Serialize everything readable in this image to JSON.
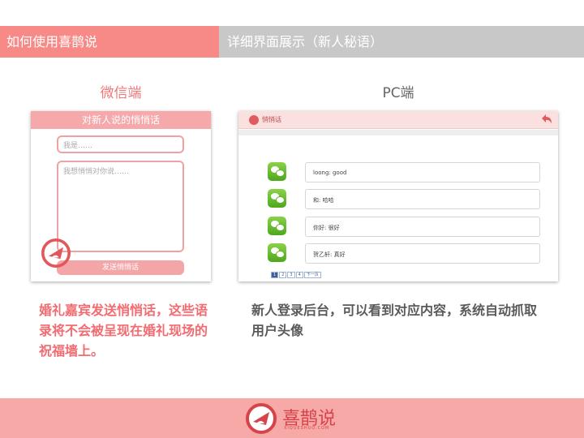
{
  "header": {
    "left_title": "如何使用喜鹊说",
    "right_title": "详细界面展示（新人秘语）"
  },
  "weixin": {
    "column_title": "微信端",
    "panel_title": "对新人说的悄悄话",
    "name_placeholder": "我是……",
    "message_placeholder": "我想悄悄对你说……",
    "send_label": "发送悄悄话",
    "description": "婚礼嘉宾发送悄悄话，这些语录将不会被呈现在婚礼现场的祝福墙上。"
  },
  "pc": {
    "column_title": "PC端",
    "panel_title": "悄悄话",
    "messages": [
      {
        "text": "loong:  good"
      },
      {
        "text": "和:  哈哈"
      },
      {
        "text": "你好:  很好"
      },
      {
        "text": "贺乙轩:  真好"
      }
    ],
    "pager": [
      "1",
      "2",
      "3",
      "4",
      "下一页"
    ],
    "description": "新人登录后台，可以看到对应内容，系统自动抓取用户头像"
  },
  "footer": {
    "brand_name": "喜鹊说",
    "brand_url": "XIQUESHUO.COM"
  },
  "colors": {
    "accent": "#f78a86",
    "gray_bar": "#c8c8c8",
    "footer_bg": "#f7a9a7",
    "brand_red": "#d6444a"
  }
}
